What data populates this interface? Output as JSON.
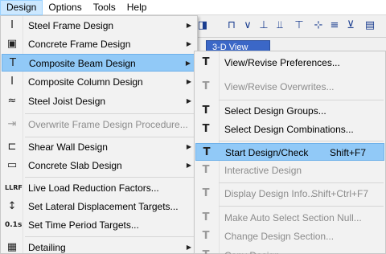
{
  "menubar": [
    "Design",
    "Options",
    "Tools",
    "Help"
  ],
  "view_tab": "3-D View",
  "design_menu": [
    {
      "label": "Steel Frame Design",
      "icon": "I",
      "submenu": true,
      "enabled": true
    },
    {
      "label": "Concrete Frame Design",
      "icon": "▣",
      "submenu": true,
      "enabled": true
    },
    {
      "label": "Composite Beam Design",
      "icon": "T",
      "submenu": true,
      "enabled": true,
      "highlighted": true
    },
    {
      "label": "Composite Column Design",
      "icon": "Ⅰ",
      "submenu": true,
      "enabled": true
    },
    {
      "label": "Steel Joist Design",
      "icon": "≈",
      "submenu": true,
      "enabled": true
    },
    {
      "label": "Overwrite Frame Design Procedure...",
      "icon": "⇥",
      "submenu": false,
      "enabled": false
    },
    {
      "label": "Shear Wall Design",
      "icon": "⊏",
      "submenu": true,
      "enabled": true
    },
    {
      "label": "Concrete Slab Design",
      "icon": "▭",
      "submenu": true,
      "enabled": true
    },
    {
      "label": "Live Load Reduction Factors...",
      "icon": "LLRF",
      "submenu": false,
      "enabled": true
    },
    {
      "label": "Set Lateral Displacement Targets...",
      "icon": "↕",
      "submenu": false,
      "enabled": true
    },
    {
      "label": "Set Time Period Targets...",
      "icon": "0.1s",
      "submenu": false,
      "enabled": true
    },
    {
      "label": "Detailing",
      "icon": "▦",
      "submenu": true,
      "enabled": true
    }
  ],
  "composite_beam_submenu": [
    {
      "label": "View/Revise Preferences...",
      "shortcut": "",
      "enabled": true
    },
    {
      "label": "View/Revise Overwrites...",
      "shortcut": "",
      "enabled": false
    },
    {
      "label": "Select Design Groups...",
      "shortcut": "",
      "enabled": true
    },
    {
      "label": "Select Design Combinations...",
      "shortcut": "",
      "enabled": true
    },
    {
      "label": "Start Design/Check",
      "shortcut": "Shift+F7",
      "enabled": true,
      "highlighted": true
    },
    {
      "label": "Interactive Design",
      "shortcut": "",
      "enabled": false
    },
    {
      "label": "Display Design Info...",
      "shortcut": "Shift+Ctrl+F7",
      "enabled": false
    },
    {
      "label": "Make Auto Select Section Null...",
      "shortcut": "",
      "enabled": false
    },
    {
      "label": "Change Design Section...",
      "shortcut": "",
      "enabled": false
    },
    {
      "label": "Copy Design",
      "shortcut": "",
      "enabled": false
    }
  ],
  "submenu_icon": "T"
}
